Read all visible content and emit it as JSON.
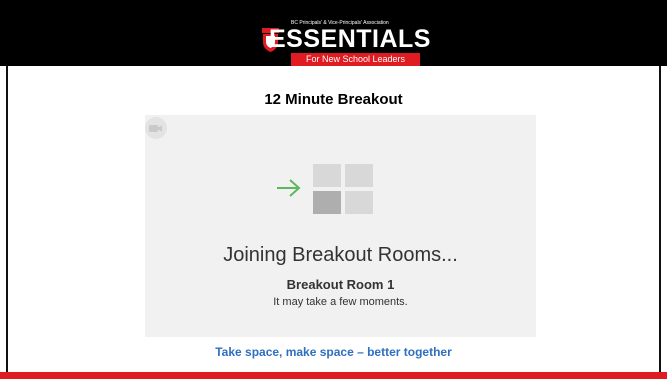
{
  "header": {
    "logo": {
      "association": "BC Principals' & Vice-Principals' Association",
      "wordmark": "ESSENTIALS",
      "tagline": "For New School Leaders"
    }
  },
  "slide": {
    "title": "12 Minute Breakout",
    "footer_tagline": "Take space, make space – better together"
  },
  "breakout_dialog": {
    "status": "Joining Breakout Rooms...",
    "room_name": "Breakout Room 1",
    "note": "It may take a few moments.",
    "icons": [
      "video-camera-icon",
      "arrow-right-icon",
      "breakout-grid-icon"
    ]
  },
  "colors": {
    "header_bg": "#000000",
    "accent_red": "#e11b22",
    "arrow_green": "#5cb85c",
    "tagline_blue": "#2f6fc0",
    "panel_bg": "#f1f1f1"
  }
}
